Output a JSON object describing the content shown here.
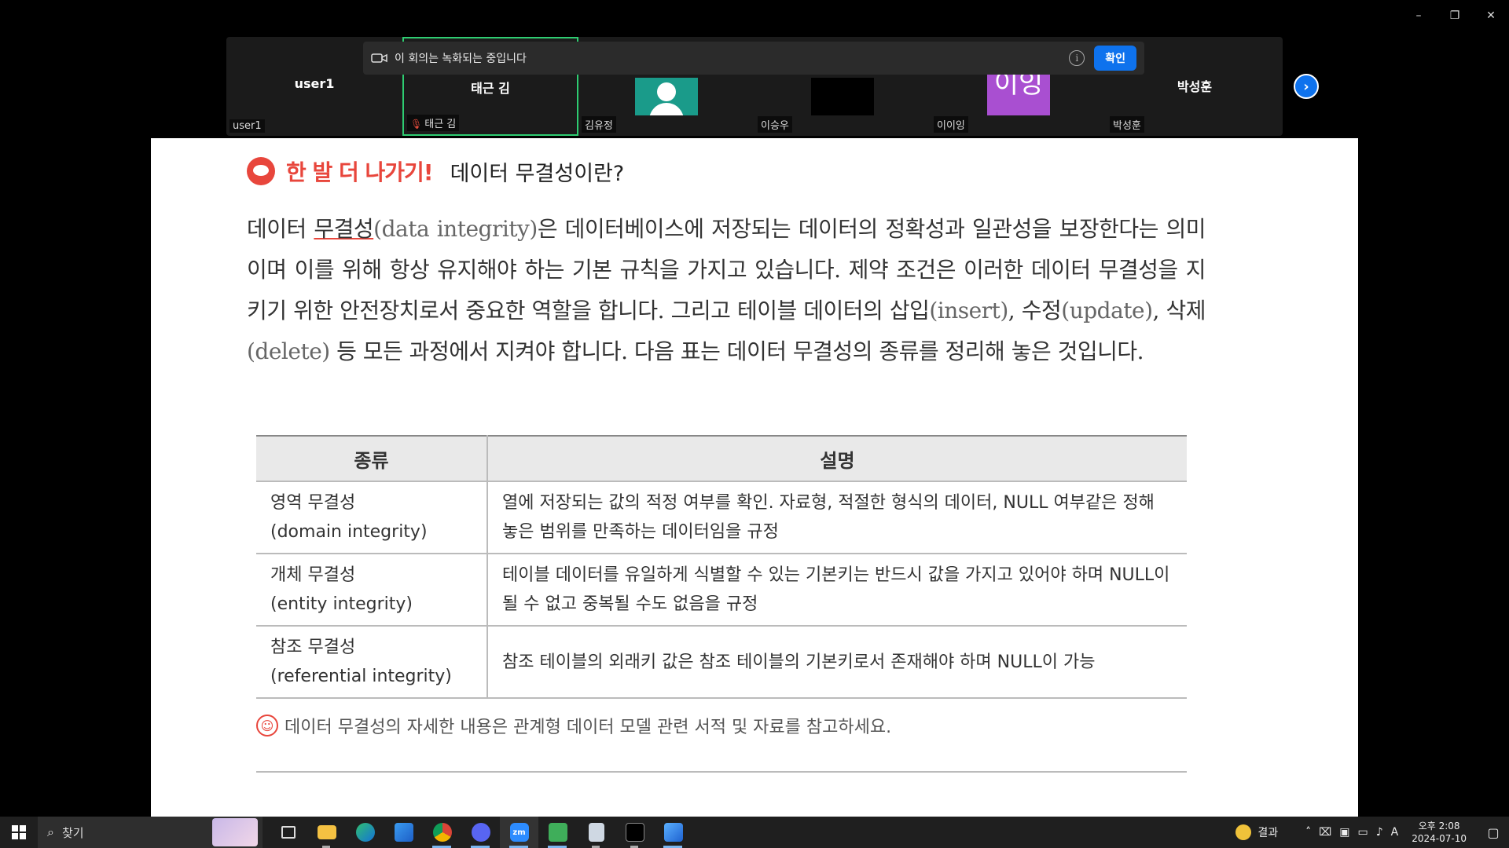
{
  "window": {
    "minimize": "–",
    "restore": "❐",
    "close": "✕"
  },
  "participants": [
    {
      "center_name": "user1",
      "label": "user1"
    },
    {
      "center_name": "태근 김",
      "label": "태근 김"
    },
    {
      "label": "김유정"
    },
    {
      "label": "이승우"
    },
    {
      "avatar_text": "이잉",
      "label": "이이잉"
    },
    {
      "center_name": "박성훈",
      "label": "박성훈"
    }
  ],
  "recording": {
    "text": "이 회의는 녹화되는 중입니다",
    "info": "i",
    "confirm": "확인"
  },
  "document": {
    "brand": "한 발 더 나가기!",
    "title": "데이터 무결성이란?",
    "para": {
      "p1": "데이터 ",
      "p2": "무결성",
      "p3": "(data integrity)",
      "p4": "은 데이터베이스에 저장되는 데이터의 정확성과 일관성을 보장한다는 의미이며 이를 위해 항상 유지해야 하는 기본 규칙을 가지고 있습니다. 제약 조건은 이러한 데이터 무결성을 지키기 위한 안전장치로서 중요한 역할을 합니다. 그리고 테이블 데이터의 삽입",
      "p5": "(insert)",
      "p6": ", 수정",
      "p7": "(update)",
      "p8": ", 삭제",
      "p9": "(delete)",
      "p10": " 등 모든 과정에서 지켜야 합니다. 다음 표는 데이터 무결성의 종류를 정리해 놓은 것입니다."
    },
    "table": {
      "headers": [
        "종류",
        "설명"
      ],
      "rows": [
        {
          "kind": "영역 무결성",
          "kind_en": "(domain integrity)",
          "desc": "열에 저장되는 값의 적정 여부를 확인. 자료형, 적절한 형식의 데이터, NULL 여부같은 정해 놓은 범위를 만족하는 데이터임을 규정"
        },
        {
          "kind": "개체 무결성",
          "kind_en": "(entity integrity)",
          "desc": "테이블 데이터를 유일하게 식별할 수 있는 기본키는 반드시 값을 가지고 있어야 하며 NULL이 될 수 없고 중복될 수도 없음을 규정"
        },
        {
          "kind": "참조 무결성",
          "kind_en": "(referential integrity)",
          "desc": "참조 테이블의 외래키 값은 참조 테이블의 기본키로서 존재해야 하며 NULL이 가능"
        }
      ]
    },
    "note": "데이터 무결성의 자세한 내용은 관계형 데이터 모델 관련 서적 및 자료를 참고하세요."
  },
  "taskbar": {
    "search_label": "찾기",
    "apps": [
      "task-view",
      "file-explorer",
      "edge",
      "store",
      "chrome",
      "discord",
      "zoom",
      "media-app",
      "notepad",
      "terminal",
      "editor"
    ],
    "zoom_label": "zm",
    "weather_label": "결과",
    "ime": "A",
    "time": "오후 2:08",
    "date": "2024-07-10"
  },
  "colors": {
    "brand_red": "#e8463c",
    "zoom_blue": "#0e72ed",
    "active_tile": "#2ecc71"
  }
}
